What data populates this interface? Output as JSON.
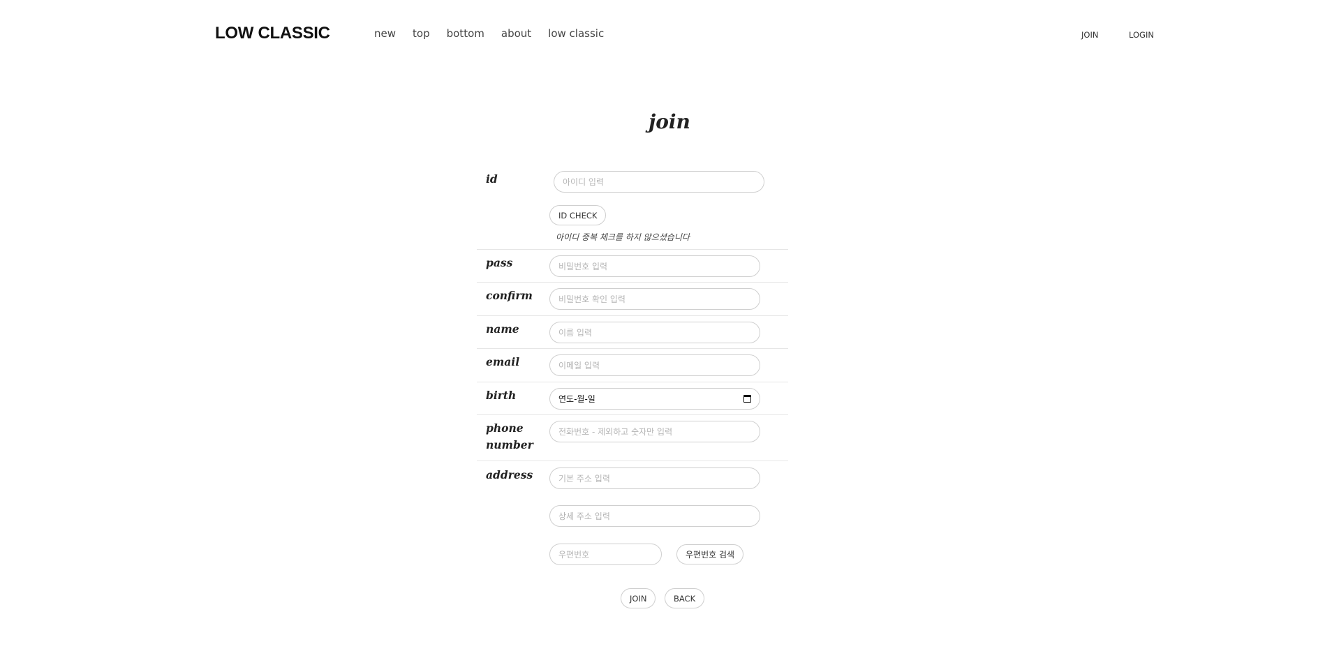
{
  "header": {
    "logo": "LOW CLASSIC",
    "nav": [
      "new",
      "top",
      "bottom",
      "about",
      "low classic"
    ],
    "join_label": "JOIN",
    "login_label": "LOGIN"
  },
  "page": {
    "title": "join"
  },
  "form": {
    "id": {
      "label": "id",
      "placeholder": "아이디 입력",
      "check_button": "ID CHECK",
      "check_message": "아이디 중복 체크를 하지 않으셨습니다"
    },
    "pass": {
      "label": "pass",
      "placeholder": "비밀번호 입력"
    },
    "confirm": {
      "label": "confirm",
      "placeholder": "비밀번호 확인 입력"
    },
    "name": {
      "label": "name",
      "placeholder": "이름 입력"
    },
    "email": {
      "label": "email",
      "placeholder": "이메일 입력"
    },
    "birth": {
      "label": "birth",
      "value": "연도-월-일"
    },
    "phone": {
      "label_line1": "phone",
      "label_line2": "number",
      "placeholder": "전화번호 - 제외하고 숫자만 입력"
    },
    "address": {
      "label": "address",
      "base_placeholder": "기본 주소 입력",
      "detail_placeholder": "상세 주소 입력",
      "zip_placeholder": "우편번호",
      "zip_search_button": "우편번호 검색"
    }
  },
  "actions": {
    "join_label": "JOIN",
    "back_label": "BACK"
  }
}
